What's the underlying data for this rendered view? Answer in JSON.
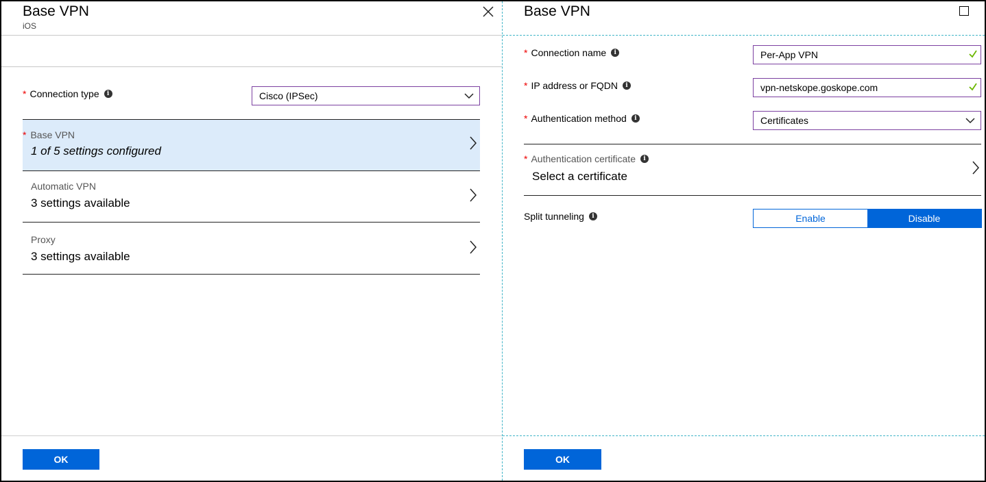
{
  "left_blade": {
    "title": "Base VPN",
    "subtitle": "iOS",
    "connection_type": {
      "label": "Connection type",
      "value": "Cisco (IPSec)"
    },
    "nav_items": [
      {
        "label": "Base VPN",
        "value": "1 of 5 settings configured",
        "required": true,
        "selected": true
      },
      {
        "label": "Automatic VPN",
        "value": "3 settings available",
        "required": false,
        "selected": false
      },
      {
        "label": "Proxy",
        "value": "3 settings available",
        "required": false,
        "selected": false
      }
    ],
    "ok_label": "OK"
  },
  "right_blade": {
    "title": "Base VPN",
    "connection_name": {
      "label": "Connection name",
      "value": "Per-App VPN"
    },
    "ip_address": {
      "label": "IP address or FQDN",
      "value": "vpn-netskope.goskope.com"
    },
    "auth_method": {
      "label": "Authentication method",
      "value": "Certificates"
    },
    "auth_cert": {
      "label": "Authentication certificate",
      "value": "Select a certificate"
    },
    "split_tunneling": {
      "label": "Split tunneling",
      "enable_label": "Enable",
      "disable_label": "Disable",
      "selected": "Disable"
    },
    "ok_label": "OK"
  },
  "required_marker": "*",
  "info_glyph": "i",
  "colors": {
    "accent": "#0065d9",
    "selected_bg": "#dcebfa",
    "field_border": "#7b3fa0",
    "required": "#e00000",
    "check": "#6bb700",
    "divider_dashed": "#3fb4c7"
  },
  "icons": {
    "close": "close-icon",
    "maximize": "maximize-icon",
    "info": "info-icon",
    "chevron_right": "chevron-right-icon",
    "chevron_down": "chevron-down-icon",
    "check": "check-icon"
  }
}
